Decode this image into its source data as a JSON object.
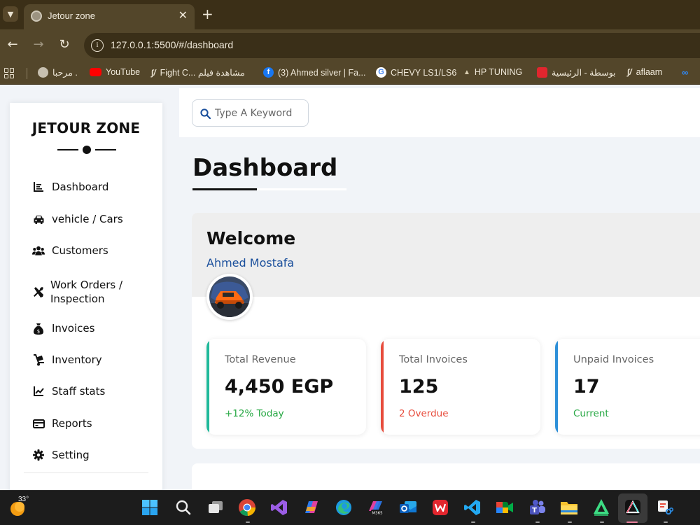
{
  "browser": {
    "tab_title": "Jetour zone",
    "url": "127.0.0.1:5500/#/dashboard",
    "bookmarks": [
      {
        "label": "مرحبا .",
        "icon": "globe-icon",
        "color": "#c7c0b0"
      },
      {
        "label": "YouTube",
        "icon": "youtube-icon",
        "color": "#ff0000"
      },
      {
        "label": "Fight C... مشاهدة فيلم",
        "icon": "fire-icon",
        "color": "#e9e1d0"
      },
      {
        "label": "(3) Ahmed silver | Fa...",
        "icon": "facebook-icon",
        "color": "#1877f2"
      },
      {
        "label": "CHEVY LS1/LS6",
        "icon": "google-icon",
        "color": "#ffffff"
      },
      {
        "label": "HP TUNING",
        "icon": "hp-icon",
        "color": "#d8cdb0"
      },
      {
        "label": "بوسطة - الرئيسية",
        "icon": "bosta-icon",
        "color": "#e0262e"
      },
      {
        "label": "aflaam",
        "icon": "fire-icon",
        "color": "#e9e1d0"
      }
    ]
  },
  "sidebar": {
    "brand": "JETOUR ZONE",
    "items": [
      {
        "label": "Dashboard",
        "icon": "chart-icon"
      },
      {
        "label": "vehicle / Cars",
        "icon": "car-icon"
      },
      {
        "label": "Customers",
        "icon": "users-icon"
      },
      {
        "label": "Work Orders /",
        "label2": "Inspection",
        "icon": "tools-icon"
      },
      {
        "label": "Invoices",
        "icon": "money-bag-icon"
      },
      {
        "label": "Inventory",
        "icon": "dolly-icon"
      },
      {
        "label": "Staff stats",
        "icon": "line-chart-icon"
      },
      {
        "label": "Reports",
        "icon": "credit-card-icon"
      },
      {
        "label": "Setting",
        "icon": "gear-icon"
      }
    ]
  },
  "search": {
    "placeholder": "Type A Keyword"
  },
  "page": {
    "title": "Dashboard"
  },
  "welcome": {
    "title": "Welcome",
    "user": "Ahmed Mostafa"
  },
  "stats": [
    {
      "label": "Total Revenue",
      "value": "4,450 EGP",
      "note": "+12% Today",
      "accent": "#20b99a",
      "note_color": "#27a844"
    },
    {
      "label": "Total Invoices",
      "value": "125",
      "note": "2 Overdue",
      "accent": "#e74c3c",
      "note_color": "#e74c3c"
    },
    {
      "label": "Unpaid Invoices",
      "value": "17",
      "note": "Current",
      "accent": "#2d8fd8",
      "note_color": "#27a844"
    }
  ],
  "taskbar": {
    "temperature": "33°",
    "apps": [
      "windows-start-icon",
      "search-icon",
      "task-view-icon",
      "chrome-icon",
      "visual-studio-icon",
      "copilot-icon",
      "edge-icon",
      "m365-icon",
      "outlook-icon",
      "wps-icon",
      "vscode-icon",
      "meet-icon",
      "teams-icon",
      "file-explorer-icon",
      "android-studio-icon",
      "capcut-icon",
      "snipping-tool-icon"
    ]
  }
}
